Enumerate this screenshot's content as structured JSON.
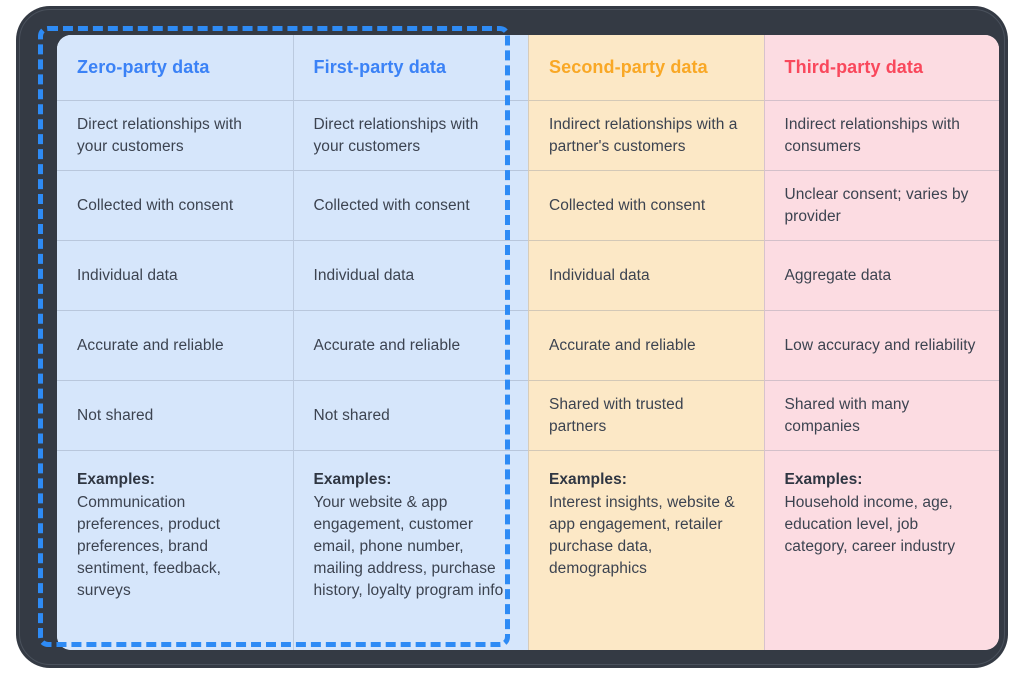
{
  "diagram": {
    "title": "Data types comparison table",
    "colors": {
      "zero_party": "#3b82f6",
      "first_party": "#3b82f6",
      "second_party": "#f9a826",
      "third_party": "#f9485c",
      "blue_cell_bg": "#d6e6fb",
      "orange_cell_bg": "#fce8c6",
      "pink_cell_bg": "#fcdce2",
      "selection_border": "#2e8bf5",
      "frame": "#343a44",
      "body_text": "#3c4350"
    },
    "columns": [
      {
        "header": "Zero-party data",
        "rows": [
          "Direct relationships with your customers",
          "Collected with consent",
          "Individual data",
          "Accurate and reliable",
          "Not shared"
        ],
        "examples_label": "Examples:",
        "examples_text": "Communication preferences, product preferences, brand sentiment, feedback, surveys"
      },
      {
        "header": "First-party data",
        "rows": [
          "Direct relationships with your customers",
          "Collected with consent",
          "Individual data",
          "Accurate and reliable",
          "Not shared"
        ],
        "examples_label": "Examples:",
        "examples_text": "Your website & app engagement, customer email, phone number, mailing address, purchase history, loyalty program info"
      },
      {
        "header": "Second-party data",
        "rows": [
          "Indirect relationships with a partner's customers",
          "Collected with consent",
          "Individual data",
          "Accurate and reliable",
          "Shared with trusted partners"
        ],
        "examples_label": "Examples:",
        "examples_text": "Interest insights, website & app engagement, retailer purchase data, demographics"
      },
      {
        "header": "Third-party data",
        "rows": [
          "Indirect relationships with consumers",
          "Unclear consent; varies by provider",
          "Aggregate data",
          "Low accuracy and reliability",
          "Shared with many companies"
        ],
        "examples_label": "Examples:",
        "examples_text": "Household income, age, education level, job category, career industry"
      }
    ]
  }
}
